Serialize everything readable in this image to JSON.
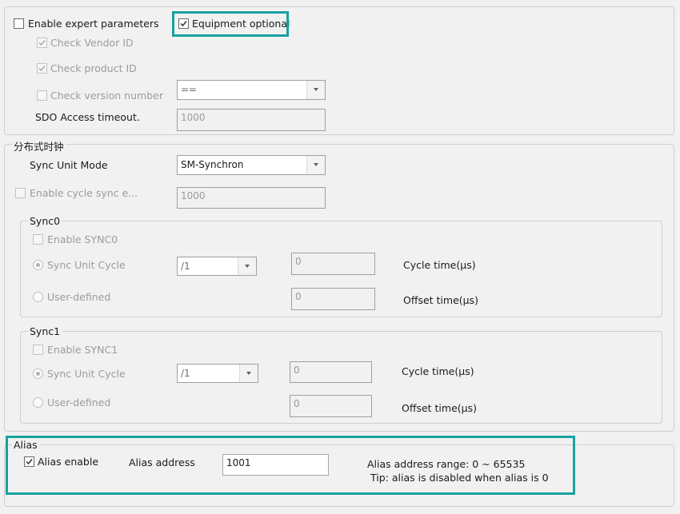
{
  "expert": {
    "enable_expert_label": "Enable expert parameters",
    "equipment_optional_label": "Equipment optional",
    "check_vendor_label": "Check Vendor ID",
    "check_product_label": "Check product ID",
    "check_version_label": "Check version number",
    "version_operator": "==",
    "sdo_label": "SDO Access timeout.",
    "sdo_value": "1000"
  },
  "dc": {
    "title": "分布式时钟",
    "sync_unit_mode_label": "Sync Unit Mode",
    "sync_unit_mode_value": "SM-Synchron",
    "enable_cycle_label": "Enable cycle sync e...",
    "cycle_value": "1000"
  },
  "sync0": {
    "title": "Sync0",
    "enable_label": "Enable SYNC0",
    "sync_unit_cycle_label": "Sync Unit Cycle",
    "divider": "/1",
    "cycle_value": "0",
    "cycle_time_label": "Cycle time(µs)",
    "user_defined_label": "User-defined",
    "offset_value": "0",
    "offset_time_label": "Offset time(µs)"
  },
  "sync1": {
    "title": "Sync1",
    "enable_label": "Enable SYNC1",
    "sync_unit_cycle_label": "Sync Unit Cycle",
    "divider": "/1",
    "cycle_value": "0",
    "cycle_time_label": "Cycle time(µs)",
    "user_defined_label": "User-defined",
    "offset_value": "0",
    "offset_time_label": "Offset time(µs)"
  },
  "alias": {
    "title": "Alias",
    "enable_label": "Alias enable",
    "address_label": "Alias address",
    "address_value": "1001",
    "range_text": "Alias address range: 0 ~ 65535",
    "tip_text": "Tip: alias is disabled when alias is 0"
  },
  "colors": {
    "highlight": "#17a2a0",
    "background": "#f1f1f1"
  }
}
